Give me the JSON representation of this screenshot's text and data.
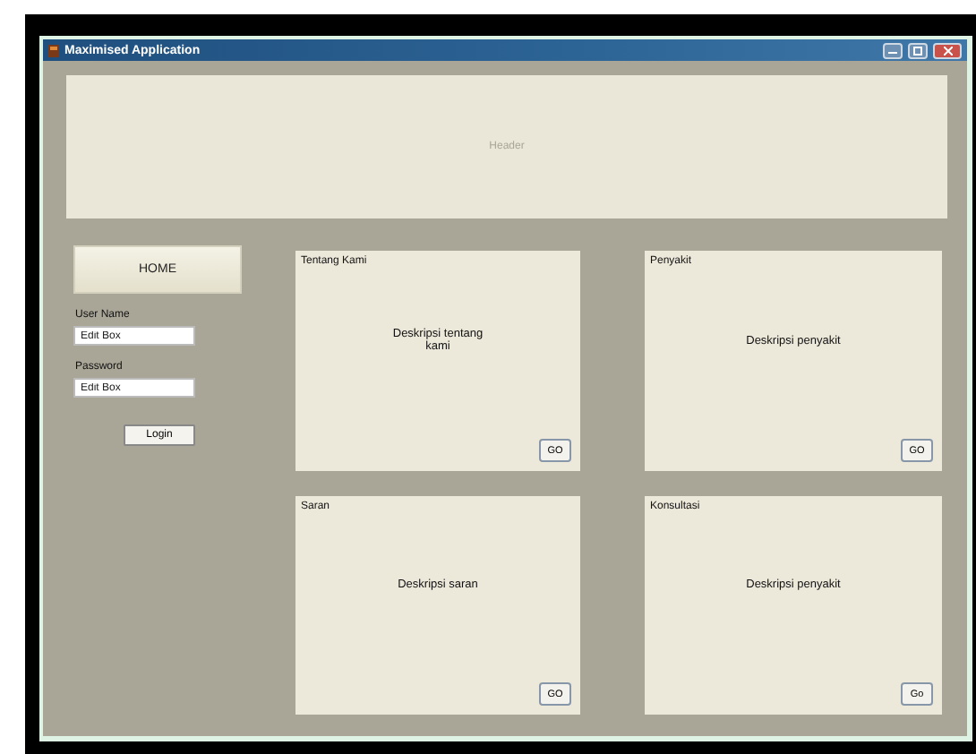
{
  "window": {
    "title": "Maximised Application"
  },
  "header": {
    "label": "Header"
  },
  "sidebar": {
    "home_button": "HOME",
    "username": {
      "label": "User Name",
      "value": "Edit Box"
    },
    "password": {
      "label": "Password",
      "value": "Edit Box"
    },
    "login_button": "Login"
  },
  "cards": [
    {
      "title": "Tentang Kami",
      "description": "Deskripsi tentang kami",
      "button": "GO"
    },
    {
      "title": "Penyakit",
      "description": "Deskripsi penyakit",
      "button": "GO"
    },
    {
      "title": "Saran",
      "description": "Deskripsi saran",
      "button": "GO"
    },
    {
      "title": "Konsultasi",
      "description": "Deskripsi penyakit",
      "button": "Go"
    }
  ]
}
